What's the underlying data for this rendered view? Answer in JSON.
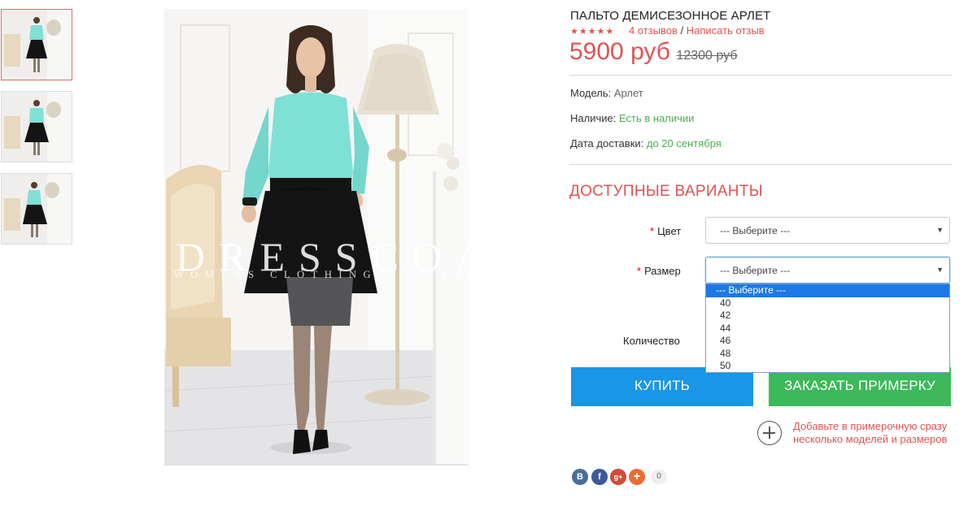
{
  "product": {
    "title": "ПАЛЬТО ДЕМИСЕЗОННОЕ АРЛЕТ",
    "rating_stars": 5,
    "reviews_link": "4 отзывов",
    "separator": "/",
    "write_review_link": "Написать отзыв",
    "price_new": "5900 руб",
    "price_old": "12300 руб"
  },
  "details": {
    "model_label": "Модель:",
    "model_value": "Арлет",
    "stock_label": "Наличие:",
    "stock_value": "Есть в наличии",
    "delivery_label": "Дата доставки:",
    "delivery_value": "до 20 сентября"
  },
  "options": {
    "title": "ДОСТУПНЫЕ ВАРИАНТЫ",
    "color": {
      "required_mark": "*",
      "label": "Цвет",
      "selected": "--- Выберите ---"
    },
    "size": {
      "required_mark": "*",
      "label": "Размер",
      "selected": "--- Выберите ---",
      "dropdown_open": true,
      "options": [
        "--- Выберите ---",
        "40",
        "42",
        "44",
        "46",
        "48",
        "50"
      ],
      "highlighted_index": 0
    },
    "quantity_label": "Количество"
  },
  "actions": {
    "buy": "КУПИТЬ",
    "order_fitting": "ЗАКАЗАТЬ ПРИМЕРКУ",
    "fitting_note": "Добавьте в примерочную сразу несколько моделей и размеров"
  },
  "watermark": {
    "brand": "DRESSCOAT",
    "subtitle": "WOMENS CLOTHING BOUTIQUE"
  },
  "share": {
    "buttons": [
      {
        "name": "vk-icon",
        "glyph": "B"
      },
      {
        "name": "facebook-icon",
        "glyph": "f"
      },
      {
        "name": "google-plus-icon",
        "glyph": "g+"
      },
      {
        "name": "more-share-icon",
        "glyph": "+"
      }
    ],
    "count": "0"
  },
  "colors": {
    "accent_red": "#e05252",
    "buy_blue": "#1a96e6",
    "fitting_green": "#3cb95a",
    "in_stock_green": "#4caf50",
    "coat_top": "#7fe0d6",
    "coat_skirt": "#141414"
  }
}
